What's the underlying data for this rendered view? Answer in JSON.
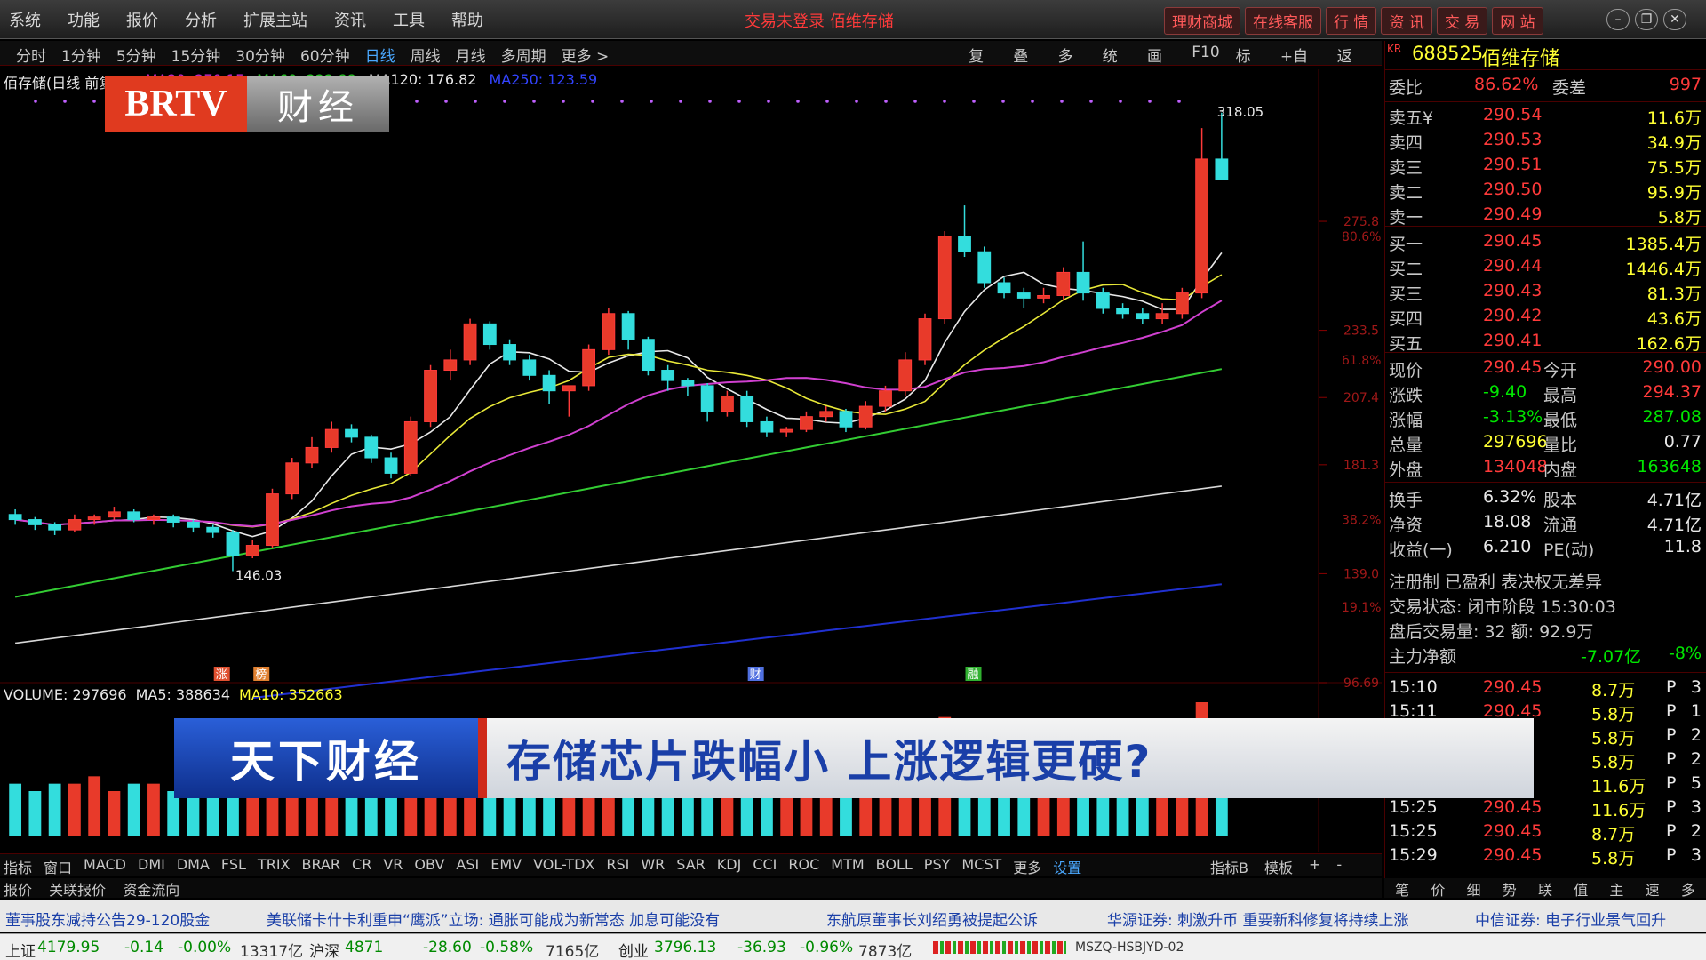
{
  "menubar": {
    "items": [
      "系统",
      "功能",
      "报价",
      "分析",
      "扩展主站",
      "资讯",
      "工具",
      "帮助"
    ],
    "alert": "交易未登录   佰维存储",
    "quick_links": [
      "理财商城",
      "在线客服",
      "行 情",
      "资 讯",
      "交 易",
      "网 站"
    ]
  },
  "period_bar": {
    "periods": [
      "分时",
      "1分钟",
      "5分钟",
      "15分钟",
      "30分钟",
      "60分钟",
      "日线",
      "周线",
      "月线",
      "多周期",
      "更多 >"
    ],
    "active": "日线",
    "tools": [
      "复权",
      "叠加",
      "多股",
      "统计",
      "画线",
      "F10",
      "标记",
      "+自选",
      "返回"
    ]
  },
  "logo": {
    "brand": "BRTV",
    "channel": "财经"
  },
  "ma_legend": {
    "name": "佰存储(日线 前复权)",
    "ma20": "MA20: 270.15",
    "ma60": "MA60: 222.88",
    "ma120": "MA120: 176.82",
    "ma250": "MA250: 123.59"
  },
  "chart_labels": {
    "high": "318.05",
    "low": "146.03",
    "right_axis": [
      "275.8",
      "233.5",
      "207.4",
      "181.3",
      "139.0",
      "96.69"
    ],
    "right_pct": [
      "80.6%",
      "61.8%",
      "38.2%",
      "19.1%"
    ],
    "markers": [
      "涨",
      "榜",
      "财",
      "融"
    ]
  },
  "vol_legend": {
    "volume": "VOLUME: 297696",
    "ma5": "MA5: 388634",
    "ma10": "MA10: 352663"
  },
  "banner": {
    "program": "天下财经",
    "headline": "存储芯片跌幅小 上涨逻辑更硬?"
  },
  "quote": {
    "code": "688525",
    "name": "佰维存储",
    "ratio_label": "委比",
    "ratio": "86.62%",
    "diff_label": "委差",
    "diff": "997",
    "asks": [
      {
        "label": "卖五¥",
        "price": "290.54",
        "vol": "11.6万"
      },
      {
        "label": "卖四",
        "price": "290.53",
        "vol": "34.9万"
      },
      {
        "label": "卖三",
        "price": "290.51",
        "vol": "75.5万"
      },
      {
        "label": "卖二",
        "price": "290.50",
        "vol": "95.9万"
      },
      {
        "label": "卖一",
        "price": "290.49",
        "vol": "5.8万"
      }
    ],
    "bids": [
      {
        "label": "买一",
        "price": "290.45",
        "vol": "1385.4万"
      },
      {
        "label": "买二",
        "price": "290.44",
        "vol": "1446.4万"
      },
      {
        "label": "买三",
        "price": "290.43",
        "vol": "81.3万"
      },
      {
        "label": "买四",
        "price": "290.42",
        "vol": "43.6万"
      },
      {
        "label": "买五",
        "price": "290.41",
        "vol": "162.6万"
      }
    ],
    "stats": [
      {
        "l1": "现价",
        "v1": "290.45",
        "l2": "今开",
        "v2": "290.00"
      },
      {
        "l1": "涨跌",
        "v1": "-9.40",
        "l2": "最高",
        "v2": "294.37"
      },
      {
        "l1": "涨幅",
        "v1": "-3.13%",
        "l2": "最低",
        "v2": "287.08"
      },
      {
        "l1": "总量",
        "v1": "297696",
        "l2": "量比",
        "v2": "0.77"
      },
      {
        "l1": "外盘",
        "v1": "134048",
        "l2": "内盘",
        "v2": "163648"
      }
    ],
    "stats2": [
      {
        "l1": "换手",
        "v1": "6.32%",
        "l2": "股本",
        "v2": "4.71亿"
      },
      {
        "l1": "净资",
        "v1": "18.08",
        "l2": "流通",
        "v2": "4.71亿"
      },
      {
        "l1": "收益(一)",
        "v1": "6.210",
        "l2": "PE(动)",
        "v2": "11.8"
      }
    ],
    "info1": "注册制 已盈利 表决权无差异",
    "info2": "交易状态: 闭市阶段 15:30:03",
    "info3": "盘后交易量: 32  额: 92.9万",
    "main_flow_label": "主力净额",
    "main_flow": "-7.07亿",
    "main_flow_pct": "-8%",
    "ticks": [
      {
        "time": "15:10",
        "price": "290.45",
        "vol": "8.7万",
        "bs": "P",
        "n": "3"
      },
      {
        "time": "15:11",
        "price": "290.45",
        "vol": "5.8万",
        "bs": "P",
        "n": "1"
      },
      {
        "time": "",
        "price": "",
        "vol": "5.8万",
        "bs": "P",
        "n": "2"
      },
      {
        "time": "",
        "price": "",
        "vol": "5.8万",
        "bs": "P",
        "n": "2"
      },
      {
        "time": "",
        "price": "",
        "vol": "11.6万",
        "bs": "P",
        "n": "5"
      },
      {
        "time": "15:25",
        "price": "290.45",
        "vol": "11.6万",
        "bs": "P",
        "n": "3"
      },
      {
        "time": "15:25",
        "price": "290.45",
        "vol": "8.7万",
        "bs": "P",
        "n": "2"
      },
      {
        "time": "15:29",
        "price": "290.45",
        "vol": "5.8万",
        "bs": "P",
        "n": "3"
      }
    ],
    "bottom_tabs": [
      "笔",
      "价",
      "细",
      "势",
      "联",
      "值",
      "主",
      "速",
      "多"
    ]
  },
  "indicator_tabs": {
    "tabs": [
      "指标",
      "窗口",
      "MACD",
      "DMI",
      "DMA",
      "FSL",
      "TRIX",
      "BRAR",
      "CR",
      "VR",
      "OBV",
      "ASI",
      "EMV",
      "VOL-TDX",
      "RSI",
      "WR",
      "SAR",
      "KDJ",
      "CCI",
      "ROC",
      "MTM",
      "BOLL",
      "PSY",
      "MCST",
      "更多",
      "设置"
    ],
    "right": [
      "指标B",
      "模板",
      "+",
      "-"
    ],
    "sub": [
      "报价",
      "关联报价",
      "资金流向"
    ]
  },
  "ticker": [
    "董事股东减持公告29-120股金",
    "美联储卡什卡利重申“鹰派”立场: 通胀可能成为新常态  加息可能没有",
    "东航原董事长刘绍勇被提起公诉",
    "华源证券: 刺激升币  重要新科修复将持续上涨",
    "中信证券: 电子行业景气回升"
  ],
  "statusbar": {
    "sh_label": "上证",
    "sh": "4179.95",
    "sh_chg": "-0.14",
    "sh_pct": "-0.00%",
    "sh_amt": "13317亿",
    "sz_label": "沪深",
    "sz": "4871",
    "sz_chg": "-28.60",
    "sz_pct": "-0.58%",
    "sz_amt": "7165亿",
    "cy_label": "创业",
    "cy": "3796.13",
    "cy_chg": "-36.93",
    "cy_pct": "-0.96%",
    "cy_amt": "7873亿",
    "server": "MSZQ-HSBJYD-02"
  },
  "chart_data": {
    "type": "candlestick",
    "candles": [
      [
        162,
        164,
        158,
        160
      ],
      [
        160,
        161,
        156,
        158
      ],
      [
        158,
        159,
        154,
        156
      ],
      [
        156,
        162,
        155,
        160
      ],
      [
        160,
        162,
        158,
        161
      ],
      [
        161,
        165,
        160,
        163
      ],
      [
        163,
        164,
        159,
        160
      ],
      [
        160,
        162,
        158,
        161
      ],
      [
        161,
        162,
        157,
        159
      ],
      [
        159,
        160,
        155,
        157
      ],
      [
        157,
        158,
        153,
        155
      ],
      [
        155,
        156,
        140,
        146
      ],
      [
        146,
        152,
        145,
        150
      ],
      [
        150,
        172,
        149,
        170
      ],
      [
        170,
        184,
        168,
        182
      ],
      [
        182,
        192,
        180,
        188
      ],
      [
        188,
        198,
        186,
        195
      ],
      [
        195,
        197,
        190,
        192
      ],
      [
        192,
        193,
        182,
        184
      ],
      [
        184,
        186,
        176,
        178
      ],
      [
        178,
        200,
        177,
        198
      ],
      [
        198,
        220,
        196,
        218
      ],
      [
        218,
        226,
        214,
        222
      ],
      [
        222,
        238,
        220,
        236
      ],
      [
        236,
        237,
        226,
        228
      ],
      [
        228,
        230,
        220,
        222
      ],
      [
        222,
        224,
        214,
        216
      ],
      [
        216,
        218,
        205,
        210
      ],
      [
        210,
        212,
        200,
        212
      ],
      [
        212,
        228,
        210,
        226
      ],
      [
        226,
        242,
        224,
        240
      ],
      [
        240,
        241,
        226,
        230
      ],
      [
        230,
        231,
        216,
        218
      ],
      [
        218,
        220,
        210,
        214
      ],
      [
        214,
        215,
        208,
        212
      ],
      [
        212,
        213,
        198,
        202
      ],
      [
        202,
        210,
        200,
        208
      ],
      [
        208,
        210,
        196,
        198
      ],
      [
        198,
        200,
        192,
        194
      ],
      [
        194,
        196,
        192,
        195
      ],
      [
        195,
        202,
        194,
        200
      ],
      [
        200,
        204,
        198,
        202
      ],
      [
        202,
        203,
        194,
        196
      ],
      [
        196,
        206,
        195,
        204
      ],
      [
        204,
        212,
        202,
        210
      ],
      [
        210,
        225,
        208,
        222
      ],
      [
        222,
        240,
        220,
        238
      ],
      [
        238,
        272,
        236,
        270
      ],
      [
        270,
        282,
        262,
        264
      ],
      [
        264,
        266,
        250,
        252
      ],
      [
        252,
        254,
        246,
        248
      ],
      [
        248,
        250,
        242,
        246
      ],
      [
        246,
        250,
        244,
        247
      ],
      [
        247,
        258,
        245,
        256
      ],
      [
        256,
        268,
        245,
        248
      ],
      [
        248,
        250,
        240,
        242
      ],
      [
        242,
        244,
        238,
        240
      ],
      [
        240,
        242,
        236,
        238
      ],
      [
        238,
        244,
        236,
        240
      ],
      [
        240,
        250,
        238,
        248
      ],
      [
        248,
        312,
        246,
        300
      ],
      [
        300,
        318,
        294,
        292
      ]
    ],
    "ylim": [
      96.69,
      330
    ],
    "volume": [
      7,
      6,
      7,
      7,
      8,
      6,
      7,
      7,
      6,
      6,
      8,
      9,
      7,
      14,
      13,
      12,
      11,
      9,
      10,
      9,
      12,
      15,
      13,
      14,
      10,
      9,
      9,
      10,
      9,
      12,
      14,
      11,
      10,
      9,
      8,
      10,
      9,
      9,
      8,
      7,
      9,
      9,
      8,
      9,
      10,
      12,
      14,
      16,
      13,
      11,
      9,
      9,
      8,
      10,
      12,
      10,
      9,
      9,
      9,
      11,
      18,
      15
    ]
  }
}
